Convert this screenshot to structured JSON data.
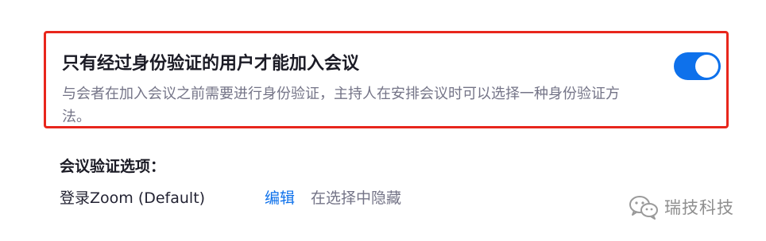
{
  "setting": {
    "title": "只有经过身份验证的用户才能加入会议",
    "description": "与会者在加入会议之前需要进行身份验证，主持人在安排会议时可以选择一种身份验证方法。",
    "toggle_on": true,
    "accent_color": "#0e71eb",
    "highlight_border_color": "#e8261c"
  },
  "options_section": {
    "label": "会议验证选项：",
    "items": [
      {
        "name": "登录Zoom (Default)",
        "edit_label": "编辑",
        "status": "在选择中隐藏"
      }
    ]
  },
  "watermark": {
    "icon": "wechat-icon",
    "text": "瑞技科技"
  }
}
